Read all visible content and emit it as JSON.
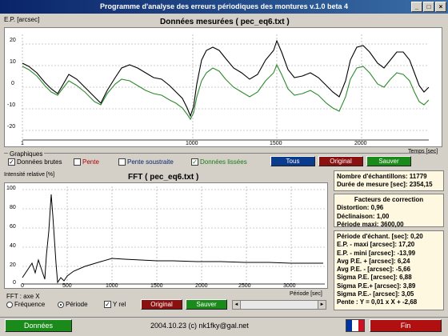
{
  "window": {
    "title": "Programme d'analyse des erreurs périodiques des montures v.1.0 beta 4"
  },
  "top_plot": {
    "ylabel": "E.P. [arcsec]",
    "title": "Données mesurées ( pec_eq6.txt )",
    "xlabel": "Temps [sec]",
    "y_ticks": [
      "20",
      "10",
      "0",
      "-10",
      "-20"
    ],
    "x_ticks": [
      "1",
      "1000",
      "1500",
      "2000"
    ]
  },
  "graphiques": {
    "group_label": "Graphiques",
    "donnees_brutes": {
      "label": "Données brutes",
      "checked": "✓"
    },
    "pente": {
      "label": "Pente",
      "checked": ""
    },
    "pente_soustraite": {
      "label": "Pente soustraite",
      "checked": ""
    },
    "donnees_lissees": {
      "label": "Données lissées",
      "checked": "✓"
    },
    "buttons": {
      "tous": "Tous",
      "original": "Original",
      "sauver": "Sauver"
    }
  },
  "fft_plot": {
    "ylabel": "Intensité relative [%]",
    "title": "FFT ( pec_eq6.txt )",
    "xlabel": "Période [sec]",
    "y_ticks": [
      "100",
      "80",
      "60",
      "40",
      "20",
      "0"
    ],
    "x_ticks": [
      "0",
      "500",
      "1000",
      "1500",
      "2000",
      "2500",
      "3000"
    ]
  },
  "fft_axis": {
    "group_label": "FFT : axe X",
    "frequence": "Fréquence",
    "periode": "Période",
    "y_rel": {
      "label": "Y rel",
      "checked": "✓"
    },
    "buttons": {
      "original": "Original",
      "sauver": "Sauver"
    }
  },
  "info_samples": {
    "line1": "Nombre d'échantillons: 11779",
    "line2": "Durée de mesure [sec]: 2354,15"
  },
  "info_correction": {
    "title": "Facteurs de correction",
    "line1": "Distortion: 0,96",
    "line2": "Déclinaison: 1,00",
    "line3": "Période maxi: 3600,00"
  },
  "info_stats": {
    "lines": [
      "Période d'échant. [sec]: 0,20",
      "E.P. - maxi [arcsec]: 17,20",
      "E.P. - mini [arcsec]: -13,99",
      "Avg P.E. + [arcsec]: 6,24",
      "Avg P.E. - [arcsec]: -5,66",
      "Sigma P.E. [arcsec]: 6,88",
      "Sigma P.E.+ [arcsec]: 3,89",
      "Sigma P.E.- [arcsec]: 3,05",
      "Pente : Y = 0,01 x X + -2,68"
    ]
  },
  "statusbar": {
    "donnees_button": "Données",
    "footer": "2004.10.23 (c) nk1fky@gal.net",
    "fin_button": "Fin"
  },
  "colors": {
    "title_bar": "#0a246a",
    "raw_series": "#000000",
    "smoothed_series": "#2e8b2e",
    "btn_blue": "#0a3b8c",
    "btn_red": "#8b1010",
    "btn_green": "#1a8a1a"
  }
}
